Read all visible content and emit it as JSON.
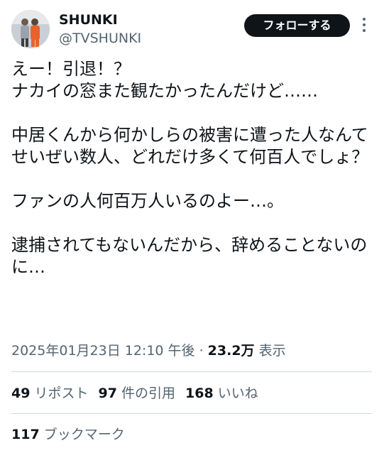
{
  "user": {
    "display_name": "SHUNKI",
    "handle": "@TVSHUNKI",
    "follow_label": "フォローする"
  },
  "tweet": {
    "text": "えー！引退！？\nナカイの窓また観たかったんだけど……\n\n中居くんから何かしらの被害に遭った人なんてせいぜい数人、どれだけ多くて何百人でしょ？\n\nファンの人何百万人いるのよー…。\n\n逮捕されてもないんだから、辞めることないのに…",
    "timestamp": "2025年01月23日 12:10 午後",
    "separator": " · ",
    "views_count": "23.2万",
    "views_label": "表示"
  },
  "stats": {
    "reposts_count": "49",
    "reposts_label": "リポスト",
    "quotes_count": "97",
    "quotes_label": "件の引用",
    "likes_count": "168",
    "likes_label": "いいね",
    "bookmarks_count": "117",
    "bookmarks_label": "ブックマーク"
  },
  "icons": {
    "more": "more-vertical-icon",
    "avatar": "avatar"
  }
}
